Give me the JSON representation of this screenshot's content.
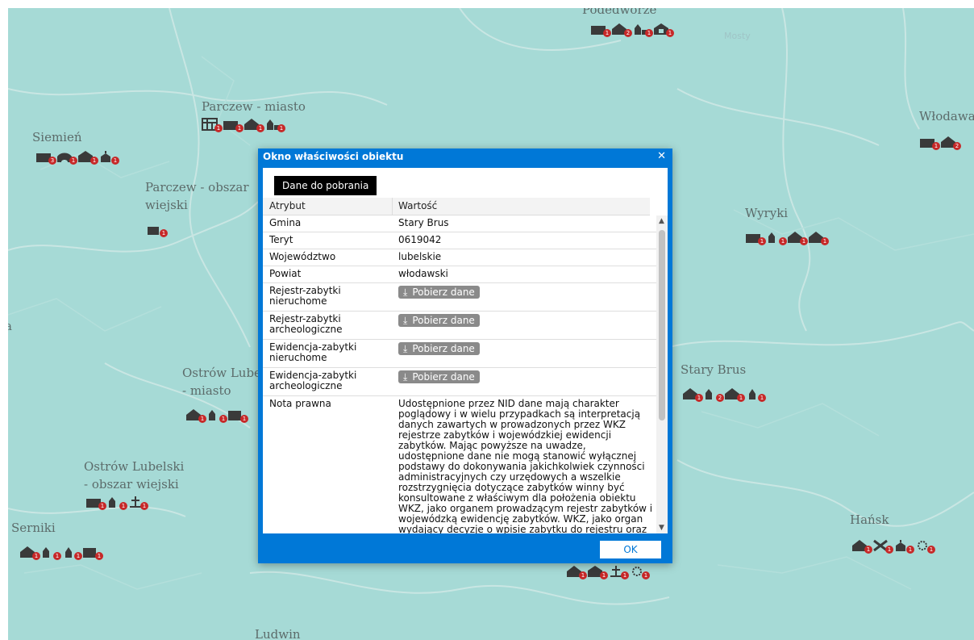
{
  "map": {
    "towns": [
      {
        "id": "parczew-miasto",
        "label": "Parczew - miasto"
      },
      {
        "id": "siemien",
        "label": "Siemień"
      },
      {
        "id": "parczew-obszar-1",
        "label": "Parczew - obszar"
      },
      {
        "id": "parczew-obszar-2",
        "label": "wiejski"
      },
      {
        "id": "wlodawa",
        "label": "Włodawa"
      },
      {
        "id": "wyryki",
        "label": "Wyryki"
      },
      {
        "id": "ostrow-miasto-1",
        "label": "Ostrów Lube"
      },
      {
        "id": "ostrow-miasto-2",
        "label": "- miasto"
      },
      {
        "id": "stary-brus",
        "label": "Stary Brus"
      },
      {
        "id": "ostrow-obszar-1",
        "label": "Ostrów Lubelski"
      },
      {
        "id": "ostrow-obszar-2",
        "label": "- obszar wiejski"
      },
      {
        "id": "serniki",
        "label": "Serniki"
      },
      {
        "id": "hansk",
        "label": "Hańsk"
      },
      {
        "id": "ludwin",
        "label": "Ludwin"
      },
      {
        "id": "podedworze",
        "label": "Podedworze"
      },
      {
        "id": "a-left",
        "label": "a"
      }
    ],
    "water_label": "Mosty"
  },
  "dialog": {
    "title": "Okno właściwości obiektu",
    "close_icon": "close-icon",
    "download_button": "Dane do pobrania",
    "columns": [
      "Atrybut",
      "Wartość"
    ],
    "rows": [
      {
        "attr": "Gmina",
        "value": "Stary Brus"
      },
      {
        "attr": "Teryt",
        "value": "0619042"
      },
      {
        "attr": "Województwo",
        "value": "lubelskie"
      },
      {
        "attr": "Powiat",
        "value": "włodawski"
      },
      {
        "attr": "Rejestr-zabytki nieruchome",
        "button": "Pobierz dane"
      },
      {
        "attr": "Rejestr-zabytki archeologiczne",
        "button": "Pobierz dane"
      },
      {
        "attr": "Ewidencja-zabytki nieruchome",
        "button": "Pobierz dane"
      },
      {
        "attr": "Ewidencja-zabytki archeologiczne",
        "button": "Pobierz dane"
      },
      {
        "attr": "Nota prawna",
        "value": "Udostępnione przez NID dane mają charakter poglądowy i w wielu przypadkach są interpretacją danych zawartych w prowadzonych przez WKZ rejestrze zabytków i wojewódzkiej ewidencji zabytków. Mając powyższe na uwadze, udostępnione dane nie mogą stanowić wyłącznej podstawy do dokonywania jakichkolwiek czynności administracyjnych czy urzędowych a wszelkie rozstrzygnięcia dotyczące zabytków winny być konsultowane z właściwym dla położenia obiektu WKZ, jako organem prowadzącym rejestr zabytków i wojewódzką ewidencję zabytków. WKZ, jako organ wydający decyzje o wpisie zabytku do rejestru oraz"
      }
    ],
    "ok_button": "OK"
  },
  "colors": {
    "dialog_blue": "#0078d7",
    "map_bg": "#a6dad6",
    "badge_red": "#c62828",
    "icon_dark": "#3a3a3a"
  }
}
